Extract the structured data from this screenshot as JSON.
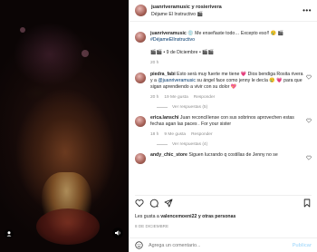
{
  "header": {
    "usernames": "juanriveramusic y rosierivera",
    "subtitle": "Déjame El Instructivo 🎬"
  },
  "caption": {
    "username": "juanriveramusic",
    "text": "💿 Me enseñaste todo… Excepto eso!! 😢 🎬",
    "hashtag": "#DéjameElInstructivo",
    "footer": "🎬🎬 • 9 de Diciembre • 🎬🎬",
    "time": "20 h"
  },
  "comments": [
    {
      "username": "piedra_fabi",
      "text": "Esto será muy fuerte me tiene 💗 Dios bendiga Rosita rivera y a",
      "mention": "@juanriveramusic",
      "text2": "su ángel face como jenny le decía 😢 💗 para que sigan aprendiendo a vivir con su dolor 💖",
      "time": "20 h",
      "likes": "19 Me gusta",
      "reply": "Responder",
      "replies": "Ver respuestas (5)"
    },
    {
      "username": "erica.lanschi",
      "text": "Juan reconcilíense con sus sobrinos aprovechen estas fechas agan las paces . For your sister",
      "mention": "",
      "text2": "",
      "time": "18 h",
      "likes": "9 Me gusta",
      "reply": "Responder",
      "replies": "Ver respuestas (4)"
    },
    {
      "username": "andy_chic_store",
      "text": "Siguen lucrando q costillas de Jenny no se",
      "mention": "",
      "text2": "",
      "time": "",
      "likes": "",
      "reply": "",
      "replies": ""
    }
  ],
  "likes": {
    "prefix": "Les gusta a",
    "user": "valencemoeni22",
    "suffix": "y otras personas"
  },
  "date": "8 DE DICIEMBRE",
  "add_comment": {
    "placeholder": "Agrega un comentario...",
    "post_label": "Publicar"
  },
  "colors": {
    "accent": "#0095f6",
    "muted": "#8e8e8e",
    "text": "#262626"
  }
}
